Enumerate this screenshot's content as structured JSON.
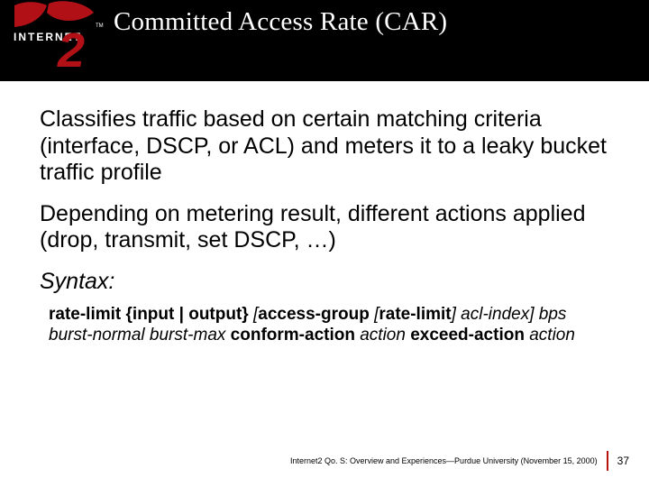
{
  "header": {
    "title": "Committed Access Rate (CAR)"
  },
  "logo": {
    "top": "INTERNET",
    "big": "2",
    "tm": "TM"
  },
  "body": {
    "p1": "Classifies traffic based on certain matching criteria (interface, DSCP, or ACL) and meters it to a leaky bucket traffic profile",
    "p2": "Depending on metering result, different actions applied (drop, transmit, set DSCP, …)",
    "syntax_label": "Syntax:",
    "code": {
      "t1": "rate-limit {input | output} ",
      "t2": "[",
      "t3": "access-group ",
      "t4": "[",
      "t5": "rate-limit",
      "t6": "]",
      "t7": " acl-index",
      "t8": "] ",
      "t9": "bps burst-normal burst-max",
      "t10": " conform-action ",
      "t11": "action",
      "t12": " exceed-action ",
      "t13": "action"
    }
  },
  "footer": {
    "text": "Internet2 Qo. S: Overview and Experiences—Purdue University (November 15, 2000)",
    "page": "37"
  }
}
